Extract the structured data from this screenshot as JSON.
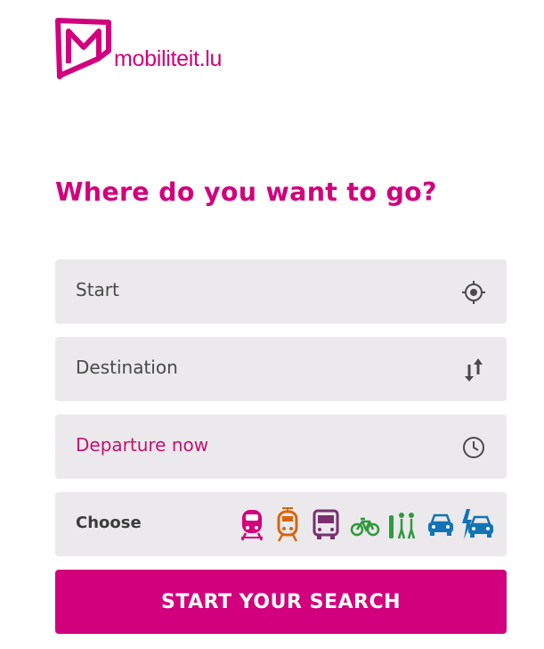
{
  "brand": {
    "name": "mobiliteit.lu",
    "logo_icon": "mobiliteit-logo-icon",
    "color": "#d2007d"
  },
  "heading": "Where do you want to go?",
  "form": {
    "start": {
      "label": "Start",
      "icon": "locate-me-icon"
    },
    "destination": {
      "label": "Destination",
      "icon": "swap-arrows-icon"
    },
    "departure": {
      "label": "Departure now",
      "icon": "clock-icon"
    },
    "modes": {
      "label": "Choose",
      "items": [
        {
          "name": "train",
          "color": "#d2007d"
        },
        {
          "name": "tram",
          "color": "#d7650f"
        },
        {
          "name": "bus",
          "color": "#7a2f6e"
        },
        {
          "name": "bike",
          "color": "#2e9a3c"
        },
        {
          "name": "walk",
          "color": "#2e9a3c"
        },
        {
          "name": "car",
          "color": "#1273b6"
        },
        {
          "name": "electric-car",
          "color": "#1273b6"
        }
      ]
    },
    "submit_label": "START YOUR SEARCH"
  }
}
